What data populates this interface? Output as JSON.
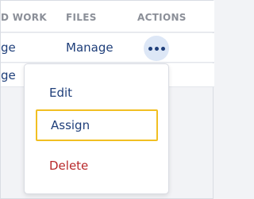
{
  "table": {
    "columns": [
      "D WORK",
      "FILES",
      "ACTIONS"
    ],
    "rows": [
      {
        "work": "ge",
        "files": "Manage"
      },
      {
        "work": "ge"
      }
    ]
  },
  "actions_button": {
    "icon": "more-horizontal-icon",
    "color": "#1f3f7a",
    "bg": "#dde7f6"
  },
  "menu": {
    "items": [
      {
        "label": "Edit",
        "color": "#1f3f7a"
      },
      {
        "label": "Assign",
        "color": "#1f3f7a",
        "focused": true,
        "focus_color": "#f1bf22"
      },
      {
        "label": "Delete",
        "color": "#b8282a"
      }
    ]
  }
}
